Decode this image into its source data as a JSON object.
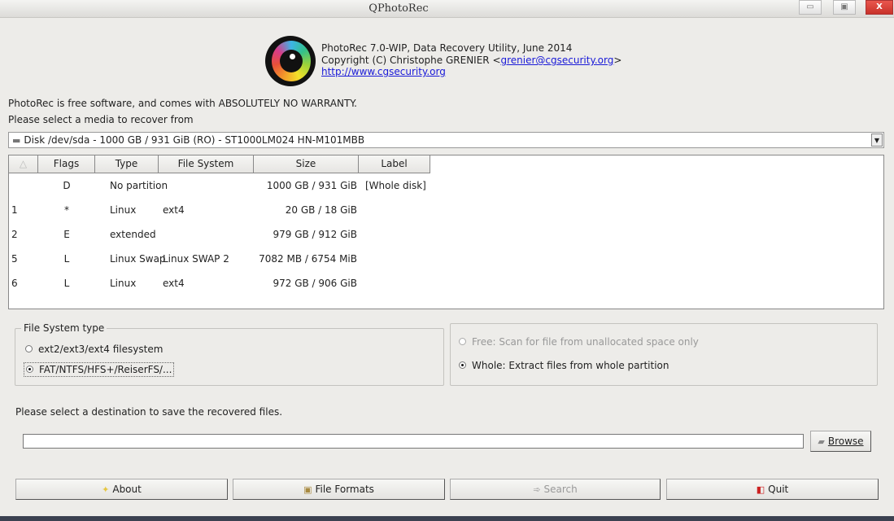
{
  "window": {
    "title": "QPhotoRec",
    "minimize": "▭",
    "maximize": "▣",
    "close": "X"
  },
  "header": {
    "line1": "PhotoRec 7.0-WIP, Data Recovery Utility, June 2014",
    "line2_prefix": "Copyright (C) Christophe GRENIER <",
    "email": "grenier@cgsecurity.org",
    "line2_suffix": ">",
    "url": "http://www.cgsecurity.org"
  },
  "warranty": "PhotoRec is free software, and comes with ABSOLUTELY NO WARRANTY.",
  "select_media": "Please select a media to recover from",
  "media_combo": {
    "value": "Disk /dev/sda - 1000 GB / 931 GiB (RO) - ST1000LM024 HN-M101MBB"
  },
  "table": {
    "headers": [
      "",
      "Flags",
      "Type",
      "File System",
      "Size",
      "Label"
    ],
    "rows": [
      {
        "num": "",
        "flags": "D",
        "type": "No partition",
        "fs": "",
        "size": "1000 GB / 931 GiB",
        "label": "[Whole disk]"
      },
      {
        "num": "1",
        "flags": "*",
        "type": "Linux",
        "fs": "ext4",
        "size": "20 GB / 18 GiB",
        "label": ""
      },
      {
        "num": "2",
        "flags": "E",
        "type": "extended",
        "fs": "",
        "size": "979 GB / 912 GiB",
        "label": ""
      },
      {
        "num": "5",
        "flags": "L",
        "type": "Linux Swap",
        "fs": "Linux SWAP 2",
        "size": "7082 MB / 6754 MiB",
        "label": ""
      },
      {
        "num": "6",
        "flags": "L",
        "type": "Linux",
        "fs": "ext4",
        "size": "972 GB / 906 GiB",
        "label": ""
      }
    ]
  },
  "fs_group": {
    "title": "File System type",
    "options": [
      "ext2/ext3/ext4 filesystem",
      "FAT/NTFS/HFS+/ReiserFS/..."
    ],
    "selected": 1
  },
  "scan_group": {
    "options": [
      "Free: Scan for file from unallocated space only",
      "Whole: Extract files from whole partition"
    ],
    "selected": 1
  },
  "destination": {
    "prompt": "Please select a destination to save the recovered files.",
    "value": "",
    "browse": "Browse"
  },
  "buttons": {
    "about": "About",
    "formats": "File Formats",
    "search": "Search",
    "quit": "Quit"
  }
}
